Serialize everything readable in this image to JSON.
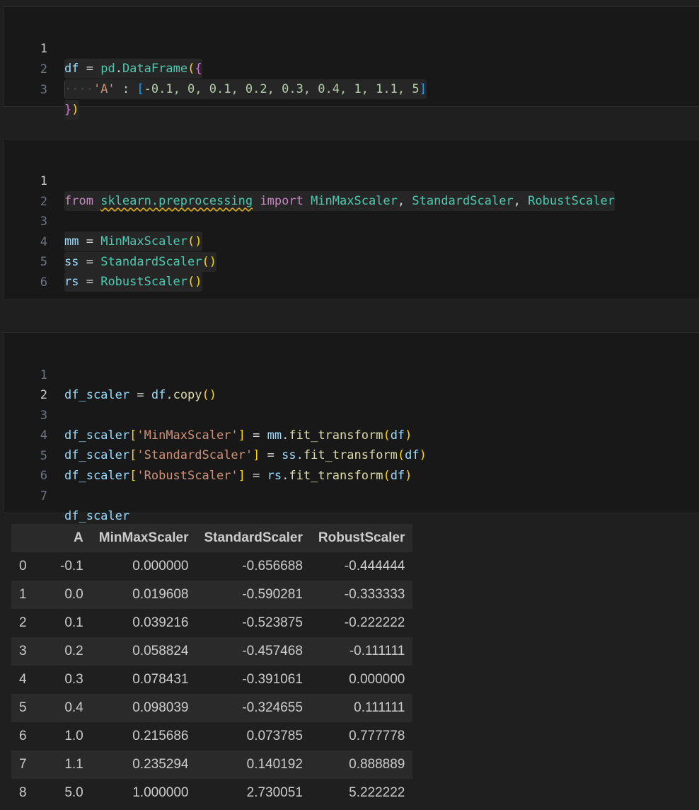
{
  "cell1": {
    "line_numbers": [
      "1",
      "2",
      "3"
    ],
    "t": {
      "df": "df",
      "eq": " = ",
      "pd": "pd",
      "dot": ".",
      "DataFrame": "DataFrame",
      "lparen": "(",
      "lbrace": "{",
      "indent": "····",
      "key": "'A'",
      "colon": " : ",
      "lbrack": "[",
      "vals": "-0.1, 0, 0.1, 0.2, 0.3, 0.4, 1, 1.1, 5",
      "rbrack": "]",
      "rbrace": "}",
      "rparen": ")"
    }
  },
  "cell2": {
    "line_numbers": [
      "1",
      "2",
      "3",
      "4",
      "5",
      "6"
    ],
    "t": {
      "from": "from",
      "module": "sklearn.preprocessing",
      "import": "import",
      "c1": "MinMaxScaler",
      "comma": ", ",
      "c2": "StandardScaler",
      "c3": "RobustScaler",
      "mm": "mm",
      "ss": "ss",
      "rs": "rs",
      "eq": " = ",
      "parens_open": "(",
      "parens_close": ")"
    }
  },
  "cell3": {
    "line_numbers": [
      "1",
      "2",
      "3",
      "4",
      "5",
      "6",
      "7"
    ],
    "t": {
      "df_scaler": "df_scaler",
      "eq": " = ",
      "df": "df",
      "dot": ".",
      "copy": "copy",
      "lp": "(",
      "rp": ")",
      "lb": "[",
      "rb": "]",
      "s1": "'MinMaxScaler'",
      "s2": "'StandardScaler'",
      "s3": "'RobustScaler'",
      "mm": "mm",
      "ss": "ss",
      "rs": "rs",
      "fit": "fit_transform"
    }
  },
  "table": {
    "columns": [
      "",
      "A",
      "MinMaxScaler",
      "StandardScaler",
      "RobustScaler"
    ],
    "rows": [
      [
        "0",
        "-0.1",
        "0.000000",
        "-0.656688",
        "-0.444444"
      ],
      [
        "1",
        "0.0",
        "0.019608",
        "-0.590281",
        "-0.333333"
      ],
      [
        "2",
        "0.1",
        "0.039216",
        "-0.523875",
        "-0.222222"
      ],
      [
        "3",
        "0.2",
        "0.058824",
        "-0.457468",
        "-0.111111"
      ],
      [
        "4",
        "0.3",
        "0.078431",
        "-0.391061",
        "0.000000"
      ],
      [
        "5",
        "0.4",
        "0.098039",
        "-0.324655",
        "0.111111"
      ],
      [
        "6",
        "1.0",
        "0.215686",
        "0.073785",
        "0.777778"
      ],
      [
        "7",
        "1.1",
        "0.235294",
        "0.140192",
        "0.888889"
      ],
      [
        "8",
        "5.0",
        "1.000000",
        "2.730051",
        "5.222222"
      ]
    ]
  }
}
